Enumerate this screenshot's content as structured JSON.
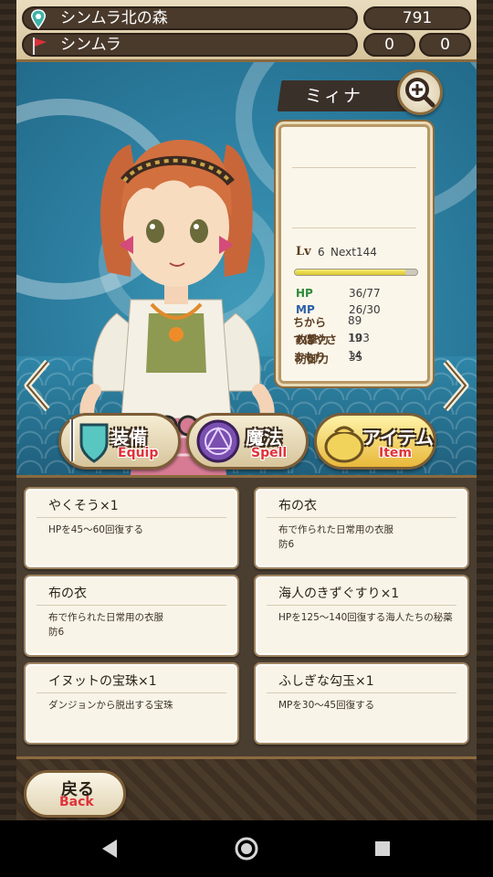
{
  "header": {
    "location": "シンムラ北の森",
    "location_count": "791",
    "town": "シンムラ",
    "town_val_1": "0",
    "town_val_2": "0"
  },
  "character": {
    "name": "ミィナ",
    "lv_label": "Lv",
    "lv_value": "6",
    "next_text": "Next144",
    "exp_fraction": 0.9,
    "stats": [
      {
        "label": "HP",
        "value": "36/77"
      },
      {
        "label": "MP",
        "value": "26/30"
      },
      {
        "label": "攻撃力",
        "value": "103"
      },
      {
        "label": "防御力",
        "value": "35"
      },
      {
        "label": "ちから",
        "value": "89"
      },
      {
        "label": "すばやさ",
        "value": "19"
      },
      {
        "label": "まもり",
        "value": "14"
      }
    ]
  },
  "tabs": [
    {
      "jp": "装備",
      "en": "Equip",
      "icon": "shield-sword-icon"
    },
    {
      "jp": "魔法",
      "en": "Spell",
      "icon": "magic-circle-icon"
    },
    {
      "jp": "アイテム",
      "en": "Item",
      "icon": "item-bag-icon"
    }
  ],
  "items": [
    {
      "name": "やくそう×1",
      "desc": "HPを45～60回復する",
      "desc2": ""
    },
    {
      "name": "布の衣",
      "desc": "布で作られた日常用の衣服",
      "desc2": "防6"
    },
    {
      "name": "布の衣",
      "desc": "布で作られた日常用の衣服",
      "desc2": "防6"
    },
    {
      "name": "海人のきずぐすり×1",
      "desc": "HPを125～140回復する海人たちの秘薬",
      "desc2": ""
    },
    {
      "name": "イヌットの宝珠×1",
      "desc": "ダンジョンから脱出する宝珠",
      "desc2": ""
    },
    {
      "name": "ふしぎな勾玉×1",
      "desc": "MPを30～45回復する",
      "desc2": ""
    }
  ],
  "back": {
    "jp": "戻る",
    "en": "Back"
  },
  "colors": {
    "accent_red": "#e0323a",
    "hp_green": "#2f8a3a",
    "mp_blue": "#2b5fa8",
    "frame_brown": "#8a6a3f"
  }
}
